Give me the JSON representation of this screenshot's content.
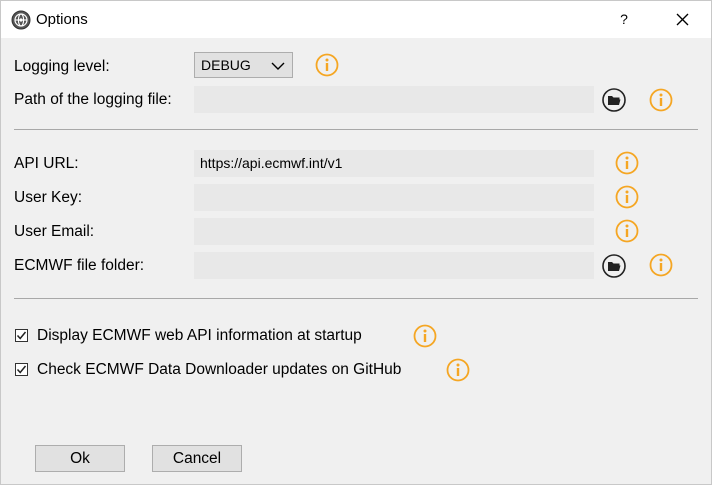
{
  "window": {
    "title": "Options",
    "help_label": "?",
    "app_icon": "globe-gear-icon",
    "close_icon": "close-icon"
  },
  "logging": {
    "level_label": "Logging level:",
    "level_value": "DEBUG",
    "path_label": "Path of the logging file:",
    "path_value": ""
  },
  "api": {
    "url_label": "API URL:",
    "url_value": "https://api.ecmwf.int/v1",
    "key_label": "User Key:",
    "key_value": "",
    "email_label": "User Email:",
    "email_value": "",
    "folder_label": "ECMWF file folder:",
    "folder_value": ""
  },
  "options": {
    "display_info_label": "Display ECMWF web API information at startup",
    "display_info_checked": true,
    "check_updates_label": "Check ECMWF Data Downloader updates on GitHub",
    "check_updates_checked": true
  },
  "buttons": {
    "ok_label": "Ok",
    "cancel_label": "Cancel"
  },
  "colors": {
    "info_accent": "#f5a623",
    "field_bg": "#e8e8e8",
    "window_bg": "#f0f0f0"
  }
}
